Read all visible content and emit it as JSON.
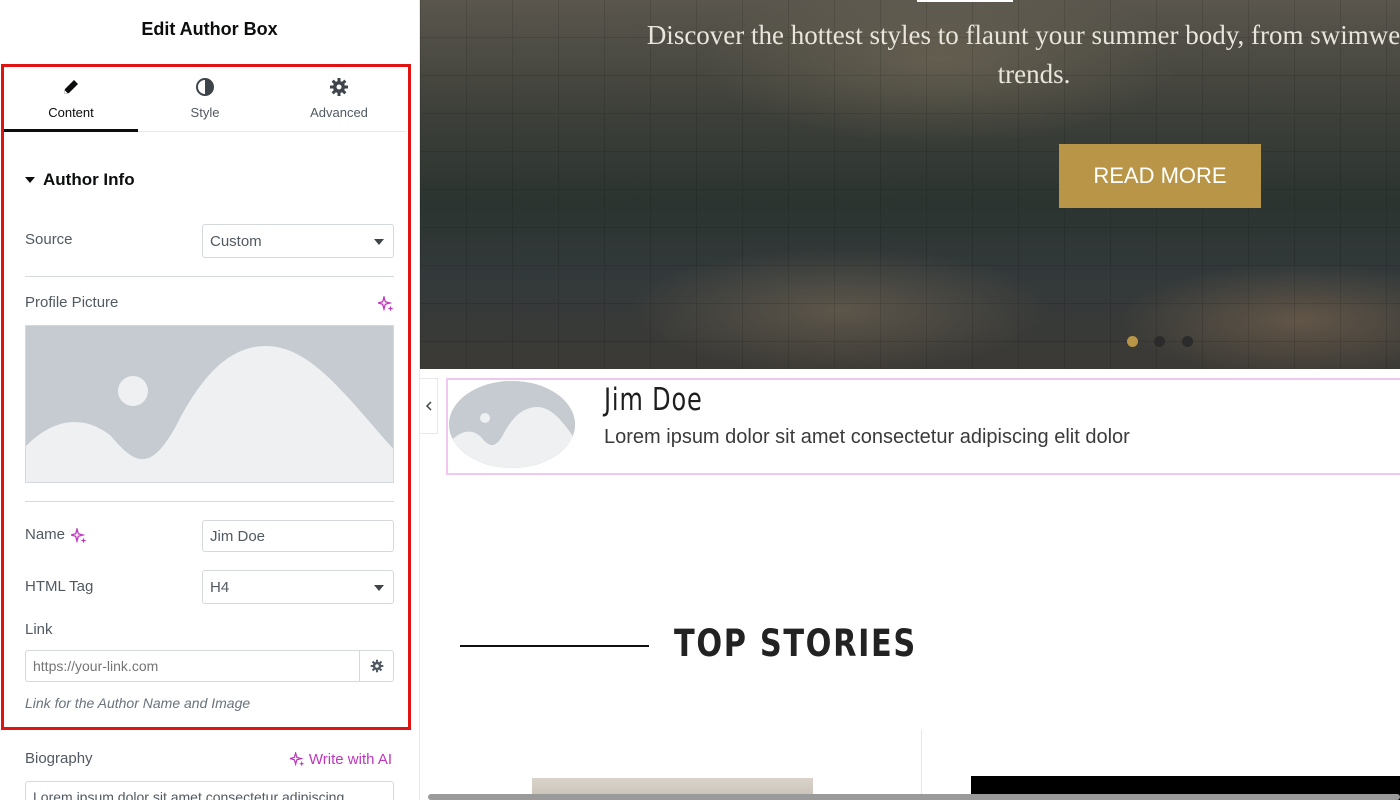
{
  "panel": {
    "title": "Edit Author Box",
    "tabs": [
      {
        "label": "Content",
        "icon": "pencil-icon",
        "active": true
      },
      {
        "label": "Style",
        "icon": "half-circle-icon",
        "active": false
      },
      {
        "label": "Advanced",
        "icon": "gear-icon",
        "active": false
      }
    ],
    "section_title": "Author Info",
    "source": {
      "label": "Source",
      "value": "Custom"
    },
    "profile_picture": {
      "label": "Profile Picture"
    },
    "name": {
      "label": "Name",
      "value": "Jim Doe"
    },
    "html_tag": {
      "label": "HTML Tag",
      "value": "H4"
    },
    "link": {
      "label": "Link",
      "placeholder": "https://your-link.com",
      "help": "Link for the Author Name and Image"
    },
    "biography": {
      "label": "Biography",
      "write_ai": "Write with AI",
      "value": "Lorem ipsum dolor sit amet consectetur adipiscing"
    }
  },
  "preview": {
    "hero": {
      "text": "Discover the hottest styles to flaunt your summer body, from swimwear trends.",
      "button": "READ MORE",
      "slides": 3,
      "active_slide": 1
    },
    "author": {
      "name": "Jim Doe",
      "bio": "Lorem ipsum dolor sit amet consectetur adipiscing elit dolor"
    },
    "section_heading": "TOP STORIES"
  },
  "colors": {
    "highlight": "#e11212",
    "accent_gold": "#b89547",
    "ai_magenta": "#c036be",
    "author_box_border": "#f0c7ef"
  }
}
